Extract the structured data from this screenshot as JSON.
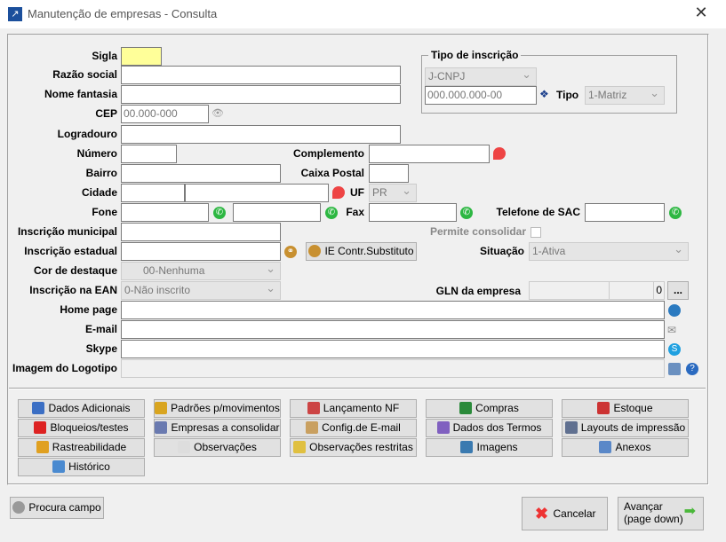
{
  "window": {
    "title": "Manutenção de empresas - Consulta",
    "close": "✕"
  },
  "labels": {
    "sigla": "Sigla",
    "razao": "Razão social",
    "fantasia": "Nome fantasia",
    "cep": "CEP",
    "logradouro": "Logradouro",
    "numero": "Número",
    "complemento": "Complemento",
    "bairro": "Bairro",
    "caixa": "Caixa Postal",
    "cidade": "Cidade",
    "uf": "UF",
    "fone": "Fone",
    "fax": "Fax",
    "sac": "Telefone de SAC",
    "im": "Inscrição municipal",
    "consolidar": "Permite consolidar",
    "ie": "Inscrição estadual",
    "situacao": "Situação",
    "cor": "Cor de destaque",
    "ean": "Inscrição na EAN",
    "gln": "GLN da empresa",
    "home": "Home page",
    "email": "E-mail",
    "skype": "Skype",
    "logo": "Imagem do Logotipo"
  },
  "values": {
    "cep_placeholder": "00.000-000",
    "uf": "PR",
    "situacao": "1-Ativa",
    "cor": "00-Nenhuma",
    "ean": "0-Não inscrito",
    "gln_count": "0"
  },
  "tipo_inscricao": {
    "title": "Tipo de inscrição",
    "type": "J-CNPJ",
    "number": "000.000.000-00",
    "tipo_label": "Tipo",
    "tipo": "1-Matriz"
  },
  "ie_button": "IE Contr.Substituto",
  "gln_button": "...",
  "actions": [
    [
      "Dados Adicionais",
      "Padrões p/movimentos",
      "Lançamento NF",
      "Compras",
      "Estoque"
    ],
    [
      "Bloqueios/testes",
      "Empresas a consolidar",
      "Config.de E-mail",
      "Dados dos Termos",
      "Layouts de impressão"
    ],
    [
      "Rastreabilidade",
      "Observações",
      "Observações restritas",
      "Imagens",
      "Anexos"
    ],
    [
      "Histórico"
    ]
  ],
  "action_colors": [
    [
      "#3b6fc4",
      "#d9a520",
      "#c44",
      "#2a8a3a",
      "#c33"
    ],
    [
      "#d22",
      "#6a7ab0",
      "#c9a060",
      "#8060c0",
      "#607090"
    ],
    [
      "#e0a020",
      "#ddd",
      "#e0c040",
      "#3a7ab0",
      "#5a88c8"
    ],
    [
      "#4a8ad0"
    ]
  ],
  "footer": {
    "search": "Procura campo",
    "cancel": "Cancelar",
    "next_line1": "Avançar",
    "next_line2": "(page down)"
  }
}
